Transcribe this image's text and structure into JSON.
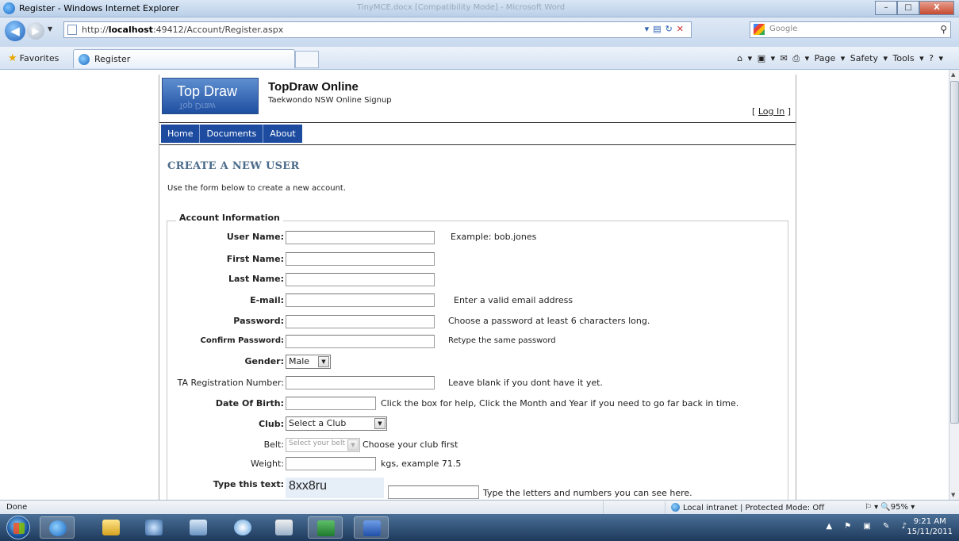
{
  "window": {
    "title": "Register - Windows Internet Explorer",
    "background_window_title": "TinyMCE.docx [Compatibility Mode] - Microsoft Word"
  },
  "address_bar": {
    "url_prefix": "http://",
    "url_host": "localhost",
    "url_rest": ":49412/Account/Register.aspx",
    "search_placeholder": "Google"
  },
  "favorites_bar": {
    "favorites_label": "Favorites",
    "tab_title": "Register",
    "command_bar": "Page ▾  Safety ▾  Tools ▾"
  },
  "site": {
    "logo_text": "Top Draw",
    "title": "TopDraw Online",
    "subtitle": "Taekwondo NSW Online Signup",
    "login_prefix": "[ ",
    "login_link": "Log In",
    "login_suffix": " ]",
    "menu": [
      "Home",
      "Documents",
      "About"
    ]
  },
  "form": {
    "heading": "CREATE A NEW USER",
    "intro": "Use the form below to create a new account.",
    "section_legend": "Account Information",
    "fields": {
      "username": {
        "label": "User Name:",
        "hint": "Example: bob.jones"
      },
      "firstname": {
        "label": "First Name:"
      },
      "lastname": {
        "label": "Last Name:"
      },
      "email": {
        "label": "E-mail:",
        "hint": "Enter a valid email address"
      },
      "password": {
        "label": "Password:",
        "hint": "Choose a password at least 6 characters long."
      },
      "confirm": {
        "label": "Confirm Password:",
        "hint": "Retype the same password"
      },
      "gender": {
        "label": "Gender:",
        "value": "Male"
      },
      "ta_reg": {
        "label": "TA Registration Number:",
        "hint": "Leave blank if you dont have it yet."
      },
      "dob": {
        "label": "Date Of Birth:",
        "hint": "Click the box for help, Click the Month and Year if you need to go far back in time."
      },
      "club": {
        "label": "Club:",
        "value": "Select a Club"
      },
      "belt": {
        "label": "Belt:",
        "value": "Select your belt",
        "hint": "Choose your club first"
      },
      "weight": {
        "label": "Weight:",
        "hint": "kgs, example 71.5"
      },
      "captcha": {
        "label": "Type this text:",
        "code": "8xx8ru",
        "hint": "Type the letters and numbers you can see here."
      }
    }
  },
  "status_bar": {
    "status": "Done",
    "zone": "Local intranet | Protected Mode: Off",
    "zoom": "95%"
  },
  "taskbar": {
    "time": "9:21 AM",
    "date": "15/11/2011"
  },
  "colors": {
    "menu_bg": "#1c4ba0",
    "heading": "#4a6b8a",
    "logo": "#2f63b8"
  }
}
